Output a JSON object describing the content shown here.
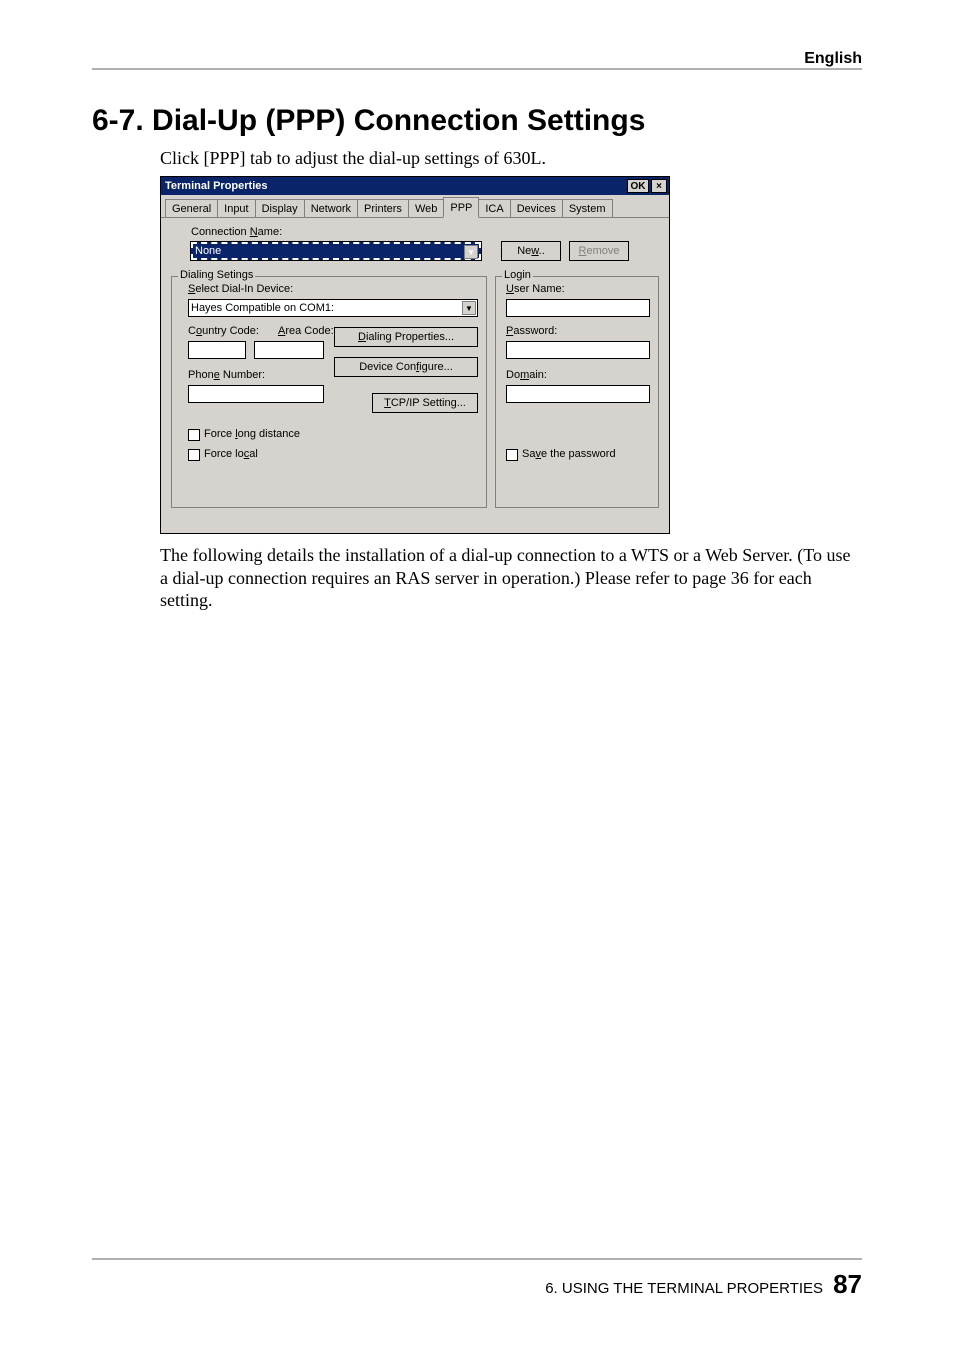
{
  "header": {
    "lang": "English"
  },
  "section": {
    "title": "6-7. Dial-Up (PPP) Connection Settings"
  },
  "intro": {
    "text": "Click [PPP] tab to adjust the dial-up settings of 630L."
  },
  "dialog": {
    "title": "Terminal Properties",
    "ok": "OK",
    "close": "×",
    "tabs": {
      "general": "General",
      "input": "Input",
      "display": "Display",
      "network": "Network",
      "printers": "Printers",
      "web": "Web",
      "ppp": "PPP",
      "ica": "ICA",
      "devices": "Devices",
      "system": "System"
    },
    "conn": {
      "name_label_pre": "Connection ",
      "name_label_u": "N",
      "name_label_post": "ame:",
      "value": "None",
      "new_pre": "Ne",
      "new_u": "w",
      "new_post": "..",
      "remove_u": "R",
      "remove_post": "emove"
    },
    "dialing": {
      "legend": "Dialing Setings",
      "select_u": "S",
      "select_post": "elect Dial-In Device:",
      "device_value": "Hayes Compatible on COM1:",
      "country_pre": "C",
      "country_u": "o",
      "country_post": "untry Code:",
      "area_u": "A",
      "area_post": "rea Code:",
      "phone_pre": "Phon",
      "phone_u": "e",
      "phone_post": " Number:",
      "dialprops_u": "D",
      "dialprops_post": "ialing Properties...",
      "devconf_pre": "Device Con",
      "devconf_u": "f",
      "devconf_post": "igure...",
      "tcpip_u": "T",
      "tcpip_post": "CP/IP Setting...",
      "forcelong_pre": "Force ",
      "forcelong_u": "l",
      "forcelong_post": "ong distance",
      "forcelocal_pre": "Force lo",
      "forcelocal_u": "c",
      "forcelocal_post": "al"
    },
    "login": {
      "legend": "Login",
      "user_u": "U",
      "user_post": "ser Name:",
      "pass_u": "P",
      "pass_post": "assword:",
      "domain_pre": "Do",
      "domain_u": "m",
      "domain_post": "ain:",
      "save_pre": "Sa",
      "save_u": "v",
      "save_post": "e the password"
    }
  },
  "body": {
    "para": "The following details the installation of a dial-up connection to a WTS or a Web Server. (To use a dial-up connection requires an RAS server in operation.)  Please refer to page 36 for each setting."
  },
  "footer": {
    "chapter": "6. USING THE TERMINAL PROPERTIES",
    "page": "87"
  }
}
